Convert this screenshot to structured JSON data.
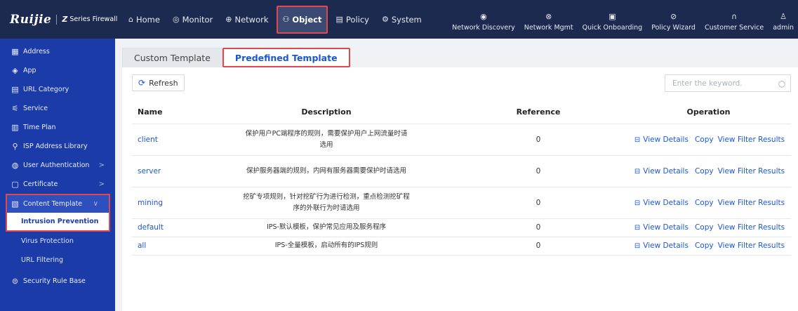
{
  "brand": {
    "logo": "Ruijie",
    "series_mark": "Z",
    "series": "Series Firewall"
  },
  "nav": [
    {
      "label": "Home",
      "icon": "home-icon",
      "glyph": "⌂"
    },
    {
      "label": "Monitor",
      "icon": "monitor-icon",
      "glyph": "◎"
    },
    {
      "label": "Network",
      "icon": "globe-icon",
      "glyph": "⊕"
    },
    {
      "label": "Object",
      "icon": "object-icon",
      "glyph": "⚇"
    },
    {
      "label": "Policy",
      "icon": "policy-icon",
      "glyph": "▤"
    },
    {
      "label": "System",
      "icon": "gear-icon",
      "glyph": "⚙"
    }
  ],
  "tools": [
    {
      "label": "Network Discovery",
      "icon": "radar-icon",
      "glyph": "◉"
    },
    {
      "label": "Network Mgmt",
      "icon": "network-mgmt-icon",
      "glyph": "⊗"
    },
    {
      "label": "Quick Onboarding",
      "icon": "onboarding-icon",
      "glyph": "▣"
    },
    {
      "label": "Policy Wizard",
      "icon": "compass-icon",
      "glyph": "⊘"
    },
    {
      "label": "Customer Service",
      "icon": "headset-icon",
      "glyph": "∩"
    },
    {
      "label": "admin",
      "icon": "user-icon",
      "glyph": "♙"
    }
  ],
  "sidebar": {
    "items": [
      {
        "label": "Address",
        "glyph": "▦"
      },
      {
        "label": "App",
        "glyph": "◈"
      },
      {
        "label": "URL Category",
        "glyph": "▤"
      },
      {
        "label": "Service",
        "glyph": "⚟"
      },
      {
        "label": "Time Plan",
        "glyph": "▥"
      },
      {
        "label": "ISP Address Library",
        "glyph": "⚲"
      },
      {
        "label": "User Authentication",
        "glyph": "◍"
      },
      {
        "label": "Certificate",
        "glyph": "▢"
      },
      {
        "label": "Content Template",
        "glyph": "▧"
      },
      {
        "label": "Security Rule Base",
        "glyph": "⊜"
      }
    ],
    "sub_items": [
      {
        "label": "Intrusion Prevention"
      },
      {
        "label": "Virus Protection"
      },
      {
        "label": "URL Filtering"
      }
    ],
    "chevron_right": ">",
    "chevron_down": "∨"
  },
  "tabs": [
    {
      "label": "Custom Template"
    },
    {
      "label": "Predefined Template"
    }
  ],
  "toolbar": {
    "refresh_label": "Refresh",
    "search_placeholder": "Enter the keyword."
  },
  "table": {
    "columns": [
      "Name",
      "Description",
      "Reference",
      "Operation"
    ],
    "rows": [
      {
        "name": "client",
        "desc": "保护用户PC端程序的规则，需要保护用户上网流量时请选用",
        "ref": "0"
      },
      {
        "name": "server",
        "desc": "保护服务器端的规则，内网有服务器需要保护时请选用",
        "ref": "0"
      },
      {
        "name": "mining",
        "desc": "挖矿专项规则，针对挖矿行为进行检测，重点检测挖矿程序的外联行为时请选用",
        "ref": "0"
      },
      {
        "name": "default",
        "desc": "IPS-默认模板，保护常见应用及服务程序",
        "ref": "0"
      },
      {
        "name": "all",
        "desc": "IPS-全量模板，启动所有的IPS规则",
        "ref": "0"
      }
    ],
    "ops": {
      "view": "View Details",
      "copy": "Copy",
      "filter": "View Filter Results"
    }
  }
}
